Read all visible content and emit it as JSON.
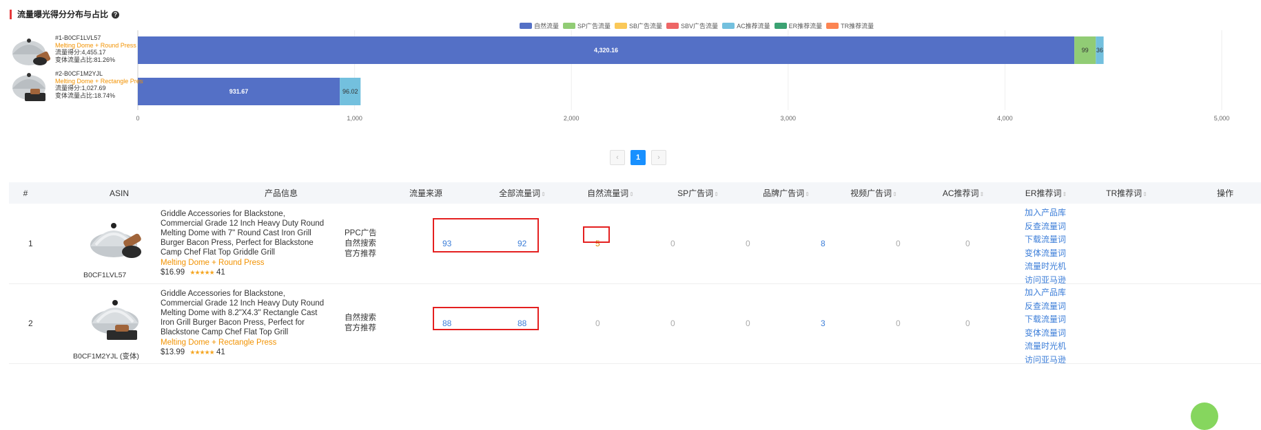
{
  "section": {
    "title": "流量曝光得分分布与占比",
    "help_icon": "?"
  },
  "colors": {
    "natural": "#5470c6",
    "sp": "#91cc75",
    "sb": "#fac858",
    "sbv": "#ee6666",
    "ac": "#73c0de",
    "er": "#3ba272",
    "tr": "#fc8452",
    "accent_red": "#e5393b",
    "link_blue": "#3b7dd8",
    "orange": "#f29200"
  },
  "legend": [
    {
      "label": "自然流量",
      "color": "#5470c6"
    },
    {
      "label": "SP广告流量",
      "color": "#91cc75"
    },
    {
      "label": "SB广告流量",
      "color": "#fac858"
    },
    {
      "label": "SBV广告流量",
      "color": "#ee6666"
    },
    {
      "label": "AC推荐流量",
      "color": "#73c0de"
    },
    {
      "label": "ER推荐流量",
      "color": "#3ba272"
    },
    {
      "label": "TR推荐流量",
      "color": "#fc8452"
    }
  ],
  "chart_rows": [
    {
      "id_line": "#1-B0CF1LVL57",
      "variant": "Melting Dome + Round Press",
      "score_line": "流量得分:4,455.17",
      "share_line": "变体流量占比:81.26%"
    },
    {
      "id_line": "#2-B0CF1M2YJL",
      "variant": "Melting Dome + Rectangle Press",
      "score_line": "流量得分:1,027.69",
      "share_line": "变体流量占比:18.74%"
    }
  ],
  "chart_data": {
    "type": "bar",
    "orientation": "horizontal",
    "stacked": true,
    "categories": [
      "#1-B0CF1LVL57",
      "#2-B0CF1M2YJL"
    ],
    "series": [
      {
        "name": "自然流量",
        "values": [
          4320.16,
          931.67
        ],
        "labels": [
          "4,320.16",
          "931.67"
        ]
      },
      {
        "name": "SP广告流量",
        "values": [
          99,
          0
        ],
        "labels": [
          "99",
          ""
        ]
      },
      {
        "name": "SB广告流量",
        "values": [
          0,
          0
        ],
        "labels": [
          "",
          ""
        ]
      },
      {
        "name": "SBV广告流量",
        "values": [
          0,
          0
        ],
        "labels": [
          "",
          ""
        ]
      },
      {
        "name": "AC推荐流量",
        "values": [
          36,
          96.02
        ],
        "labels": [
          "36",
          "96.02"
        ]
      },
      {
        "name": "ER推荐流量",
        "values": [
          0,
          0
        ],
        "labels": [
          "",
          ""
        ]
      },
      {
        "name": "TR推荐流量",
        "values": [
          0,
          0
        ],
        "labels": [
          "",
          ""
        ]
      }
    ],
    "xlim": [
      0,
      5000
    ],
    "xticks": [
      0,
      1000,
      2000,
      3000,
      4000,
      5000
    ],
    "xtick_labels": [
      "0",
      "1,000",
      "2,000",
      "3,000",
      "4,000",
      "5,000"
    ],
    "grid": true,
    "legend_position": "top"
  },
  "pagination": {
    "prev": "‹",
    "current": "1",
    "next": "›"
  },
  "table": {
    "headers": {
      "index": "#",
      "asin": "ASIN",
      "product": "产品信息",
      "source": "流量来源",
      "all_kw": "全部流量词",
      "natural_kw": "自然流量词",
      "sp_kw": "SP广告词",
      "brand_kw": "品牌广告词",
      "video_kw": "视频广告词",
      "ac_kw": "AC推荐词",
      "er_kw": "ER推荐词",
      "tr_kw": "TR推荐词",
      "ops": "操作"
    },
    "rows": [
      {
        "index": "1",
        "asin": "B0CF1LVL57",
        "title_lines": [
          "Griddle Accessories for Blackstone,",
          "Commercial Grade 12 Inch Heavy Duty Round",
          "Melting Dome with 7\" Round Cast Iron Grill",
          "Burger Bacon Press, Perfect for Blackstone",
          "Camp Chef Flat Top Griddle Grill"
        ],
        "variant": "Melting Dome + Round Press",
        "price": "$16.99",
        "stars": "★★★★★",
        "reviews": "41",
        "sources": [
          "PPC广告",
          "自然搜索",
          "官方推荐"
        ],
        "all_kw": "93",
        "natural_kw": "92",
        "sp_kw": "5",
        "brand_kw": "0",
        "video_kw": "0",
        "ac_kw": "8",
        "er_kw": "0",
        "tr_kw": "0"
      },
      {
        "index": "2",
        "asin": "B0CF1M2YJL (变体)",
        "title_lines": [
          "Griddle Accessories for Blackstone,",
          "Commercial Grade 12 Inch Heavy Duty Round",
          "Melting Dome with 8.2\"X4.3\" Rectangle Cast",
          "Iron Grill Burger Bacon Press, Perfect for",
          "Blackstone Camp Chef Flat Top Grill"
        ],
        "variant": "Melting Dome + Rectangle Press",
        "price": "$13.99",
        "stars": "★★★★★",
        "reviews": "41",
        "sources": [
          "自然搜索",
          "官方推荐"
        ],
        "all_kw": "88",
        "natural_kw": "88",
        "sp_kw": "0",
        "brand_kw": "0",
        "video_kw": "0",
        "ac_kw": "3",
        "er_kw": "0",
        "tr_kw": "0"
      }
    ],
    "actions": [
      "加入产品库",
      "反查流量词",
      "下载流量词",
      "变体流量词",
      "流量时光机",
      "访问亚马逊"
    ]
  }
}
